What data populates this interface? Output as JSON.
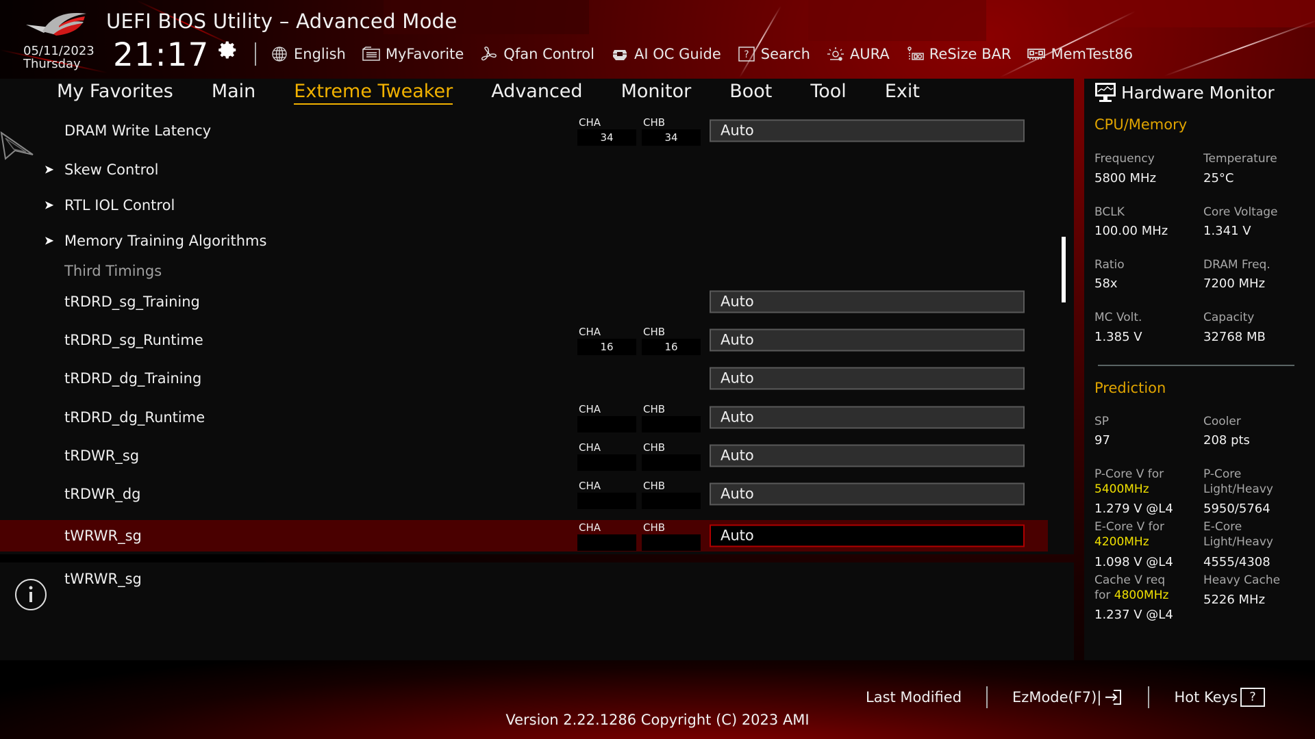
{
  "header": {
    "title": "UEFI BIOS Utility – Advanced Mode",
    "date": "05/11/2023",
    "day": "Thursday",
    "time": "21:17",
    "settings_icon": "gear-icon"
  },
  "toolbar": [
    {
      "label": "English",
      "icon": "globe-icon"
    },
    {
      "label": "MyFavorite",
      "icon": "favorite-list-icon"
    },
    {
      "label": "Qfan Control",
      "icon": "fan-icon"
    },
    {
      "label": "AI OC Guide",
      "icon": "ai-chip-icon"
    },
    {
      "label": "Search",
      "icon": "help-box-icon"
    },
    {
      "label": "AURA",
      "icon": "aura-light-icon"
    },
    {
      "label": "ReSize BAR",
      "icon": "resize-bar-icon"
    },
    {
      "label": "MemTest86",
      "icon": "memory-module-icon"
    }
  ],
  "nav": {
    "active": "Extreme Tweaker",
    "tabs": [
      "My Favorites",
      "Main",
      "Extreme Tweaker",
      "Advanced",
      "Monitor",
      "Boot",
      "Tool",
      "Exit"
    ]
  },
  "settings": [
    {
      "label": "DRAM Write Latency",
      "type": "option",
      "cha_label": "CHA",
      "chb_label": "CHB",
      "cha": "34",
      "chb": "34",
      "value": "Auto"
    },
    {
      "label": "Skew Control",
      "type": "submenu"
    },
    {
      "label": "RTL IOL Control",
      "type": "submenu"
    },
    {
      "label": "Memory Training Algorithms",
      "type": "submenu"
    },
    {
      "label": "Third Timings",
      "type": "heading"
    },
    {
      "label": "tRDRD_sg_Training",
      "type": "option",
      "value": "Auto"
    },
    {
      "label": "tRDRD_sg_Runtime",
      "type": "option",
      "cha_label": "CHA",
      "chb_label": "CHB",
      "cha": "16",
      "chb": "16",
      "value": "Auto"
    },
    {
      "label": "tRDRD_dg_Training",
      "type": "option",
      "value": "Auto"
    },
    {
      "label": "tRDRD_dg_Runtime",
      "type": "option",
      "cha_label": "CHA",
      "chb_label": "CHB",
      "cha": "",
      "chb": "",
      "value": "Auto"
    },
    {
      "label": "tRDWR_sg",
      "type": "option",
      "cha_label": "CHA",
      "chb_label": "CHB",
      "cha": "",
      "chb": "",
      "value": "Auto"
    },
    {
      "label": "tRDWR_dg",
      "type": "option",
      "cha_label": "CHA",
      "chb_label": "CHB",
      "cha": "",
      "chb": "",
      "value": "Auto"
    },
    {
      "label": "tWRWR_sg",
      "type": "option",
      "selected": true,
      "cha_label": "CHA",
      "chb_label": "CHB",
      "cha": "",
      "chb": "",
      "value": "Auto"
    }
  ],
  "info": {
    "text": "tWRWR_sg"
  },
  "hardware_monitor": {
    "title": "Hardware Monitor",
    "cpu_memory": {
      "heading": "CPU/Memory",
      "items": [
        {
          "label": "Frequency",
          "value": "5800 MHz"
        },
        {
          "label": "Temperature",
          "value": "25°C"
        },
        {
          "label": "BCLK",
          "value": "100.00 MHz"
        },
        {
          "label": "Core Voltage",
          "value": "1.341 V"
        },
        {
          "label": "Ratio",
          "value": "58x"
        },
        {
          "label": "DRAM Freq.",
          "value": "7200 MHz"
        },
        {
          "label": "MC Volt.",
          "value": "1.385 V"
        },
        {
          "label": "Capacity",
          "value": "32768 MB"
        }
      ]
    },
    "prediction": {
      "heading": "Prediction",
      "sp_label": "SP",
      "sp_value": "97",
      "cooler_label": "Cooler",
      "cooler_value": "208 pts",
      "pcore_label": "P-Core V for",
      "pcore_freq": "5400MHz",
      "pcore_value": "1.279 V @L4",
      "pcore_lh_label1": "P-Core",
      "pcore_lh_label2": "Light/Heavy",
      "pcore_lh_value": "5950/5764",
      "ecore_label": "E-Core V for",
      "ecore_freq": "4200MHz",
      "ecore_value": "1.098 V @L4",
      "ecore_lh_label1": "E-Core",
      "ecore_lh_label2": "Light/Heavy",
      "ecore_lh_value": "4555/4308",
      "cache_label1": "Cache V req",
      "cache_label2": "for",
      "cache_freq": "4800MHz",
      "cache_value": "1.237 V @L4",
      "heavy_cache_label": "Heavy Cache",
      "heavy_cache_value": "5226 MHz"
    }
  },
  "footer": {
    "last_modified": "Last Modified",
    "ezmode": "EzMode(F7)|",
    "hotkeys": "Hot Keys",
    "hotkeys_box": "?",
    "version": "Version 2.22.1286 Copyright (C) 2023 AMI"
  },
  "colors": {
    "accent": "#f2b200",
    "highlight_freq": "#f0e000",
    "selected_row": "#4a0000",
    "panel_bg": "#0b0b0b"
  }
}
